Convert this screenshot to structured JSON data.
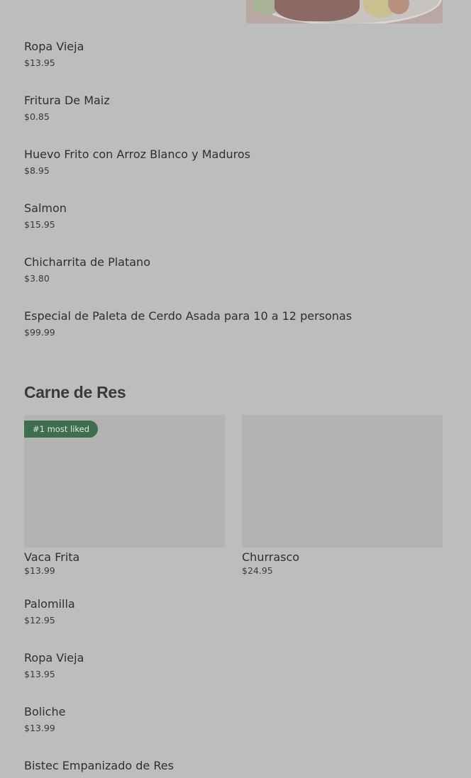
{
  "top_items": [
    {
      "name": "Ropa Vieja",
      "price": "$13.95"
    },
    {
      "name": "Fritura De Maiz",
      "price": "$0.85"
    },
    {
      "name": "Huevo Frito con Arroz Blanco y Maduros",
      "price": "$8.95"
    },
    {
      "name": "Salmon",
      "price": "$15.95"
    },
    {
      "name": "Chicharrita de Platano",
      "price": "$3.80"
    },
    {
      "name": "Especial de Paleta de Cerdo Asada para 10 a 12 personas",
      "price": "$99.99"
    }
  ],
  "section": {
    "title": "Carne de Res",
    "featured": [
      {
        "name": "Vaca Frita",
        "price": "$13.99",
        "badge": "#1 most liked"
      },
      {
        "name": "Churrasco",
        "price": "$24.95"
      }
    ],
    "items": [
      {
        "name": "Palomilla",
        "price": "$12.95"
      },
      {
        "name": "Ropa Vieja",
        "price": "$13.95"
      },
      {
        "name": "Boliche",
        "price": "$13.99"
      },
      {
        "name": "Bistec Empanizado de Res",
        "price": ""
      }
    ]
  },
  "colors": {
    "overlay_background": "#bdbdbd",
    "badge": "#3f6e4e"
  }
}
